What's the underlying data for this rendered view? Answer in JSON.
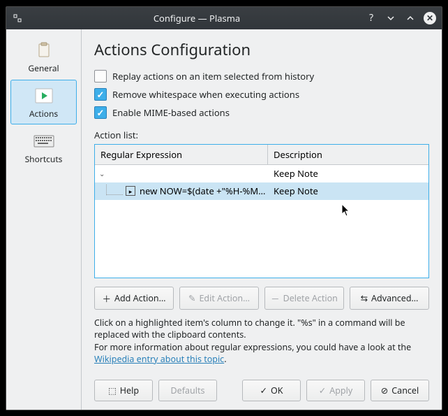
{
  "window": {
    "title": "Configure — Plasma"
  },
  "sidebar": {
    "items": [
      {
        "label": "General"
      },
      {
        "label": "Actions"
      },
      {
        "label": "Shortcuts"
      }
    ]
  },
  "main": {
    "heading": "Actions Configuration",
    "options": {
      "replay": "Replay actions on an item selected from history",
      "remove_ws": "Remove whitespace when executing actions",
      "enable_mime": "Enable MIME-based actions"
    },
    "list_label": "Action list:",
    "columns": {
      "re": "Regular Expression",
      "desc": "Description"
    },
    "tree": {
      "group_desc": "Keep Note",
      "child_cmd": "new NOW=$(date +\"%H-%M…",
      "child_desc": "Keep Note"
    },
    "buttons": {
      "add": "Add Action…",
      "edit": "Edit Action…",
      "delete": "Delete Action",
      "advanced": "Advanced…"
    },
    "help": {
      "line1": "Click on a highlighted item's column to change it. \"%s\" in a command will be replaced with the clipboard contents.",
      "line2_pre": "For more information about regular expressions, you could have a look at the ",
      "line2_link": "Wikipedia entry about this topic",
      "line2_post": "."
    }
  },
  "footer": {
    "help": "Help",
    "defaults": "Defaults",
    "ok": "OK",
    "apply": "Apply",
    "cancel": "Cancel"
  }
}
